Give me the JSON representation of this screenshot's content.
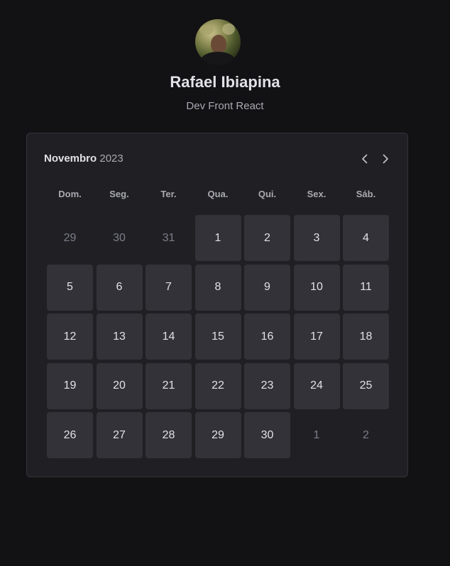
{
  "profile": {
    "name": "Rafael Ibiapina",
    "role": "Dev Front React"
  },
  "calendar": {
    "month": "Novembro",
    "year": "2023",
    "weekdays": [
      "Dom.",
      "Seg.",
      "Ter.",
      "Qua.",
      "Qui.",
      "Sex.",
      "Sáb."
    ],
    "days": [
      {
        "label": "29",
        "current": false
      },
      {
        "label": "30",
        "current": false
      },
      {
        "label": "31",
        "current": false
      },
      {
        "label": "1",
        "current": true
      },
      {
        "label": "2",
        "current": true
      },
      {
        "label": "3",
        "current": true
      },
      {
        "label": "4",
        "current": true
      },
      {
        "label": "5",
        "current": true
      },
      {
        "label": "6",
        "current": true
      },
      {
        "label": "7",
        "current": true
      },
      {
        "label": "8",
        "current": true
      },
      {
        "label": "9",
        "current": true
      },
      {
        "label": "10",
        "current": true
      },
      {
        "label": "11",
        "current": true
      },
      {
        "label": "12",
        "current": true
      },
      {
        "label": "13",
        "current": true
      },
      {
        "label": "14",
        "current": true
      },
      {
        "label": "15",
        "current": true
      },
      {
        "label": "16",
        "current": true
      },
      {
        "label": "17",
        "current": true
      },
      {
        "label": "18",
        "current": true
      },
      {
        "label": "19",
        "current": true
      },
      {
        "label": "20",
        "current": true
      },
      {
        "label": "21",
        "current": true
      },
      {
        "label": "22",
        "current": true
      },
      {
        "label": "23",
        "current": true
      },
      {
        "label": "24",
        "current": true
      },
      {
        "label": "25",
        "current": true
      },
      {
        "label": "26",
        "current": true
      },
      {
        "label": "27",
        "current": true
      },
      {
        "label": "28",
        "current": true
      },
      {
        "label": "29",
        "current": true
      },
      {
        "label": "30",
        "current": true
      },
      {
        "label": "1",
        "current": false
      },
      {
        "label": "2",
        "current": false
      }
    ],
    "nav_icons": {
      "prev": "chevron-left-icon",
      "next": "chevron-right-icon"
    }
  },
  "colors": {
    "background": "#121214",
    "card": "#202024",
    "day_cell": "#323238",
    "text_primary": "#e1e1e6",
    "text_muted": "#7c7c8a"
  }
}
